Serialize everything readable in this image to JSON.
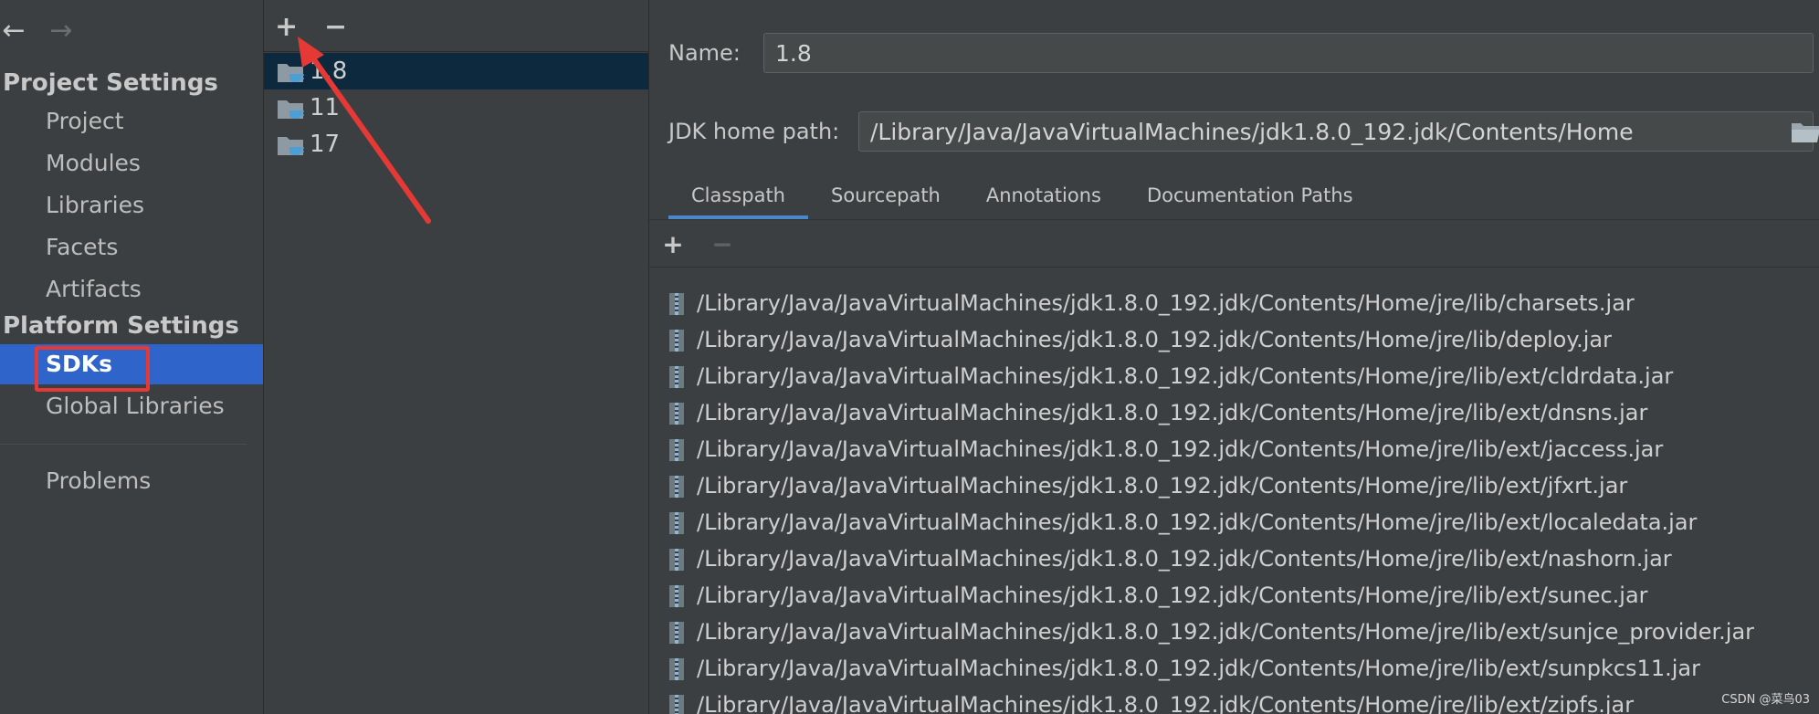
{
  "nav": {
    "back_glyph": "←",
    "forward_glyph": "→",
    "project_settings_title": "Project Settings",
    "project_items": [
      "Project",
      "Modules",
      "Libraries",
      "Facets",
      "Artifacts"
    ],
    "platform_settings_title": "Platform Settings",
    "platform_items": [
      "SDKs",
      "Global Libraries"
    ],
    "selected_item": "SDKs",
    "problems_label": "Problems"
  },
  "sdk_list": {
    "add_glyph": "+",
    "remove_glyph": "−",
    "items": [
      "1.8",
      "11",
      "17"
    ],
    "selected": "1.8"
  },
  "details": {
    "name_label": "Name:",
    "name_value": "1.8",
    "home_path_label": "JDK home path:",
    "home_path_value": "/Library/Java/JavaVirtualMachines/jdk1.8.0_192.jdk/Contents/Home",
    "tabs": [
      "Classpath",
      "Sourcepath",
      "Annotations",
      "Documentation Paths"
    ],
    "active_tab": "Classpath",
    "add_glyph": "+",
    "remove_glyph": "−",
    "classpath": [
      "/Library/Java/JavaVirtualMachines/jdk1.8.0_192.jdk/Contents/Home/jre/lib/charsets.jar",
      "/Library/Java/JavaVirtualMachines/jdk1.8.0_192.jdk/Contents/Home/jre/lib/deploy.jar",
      "/Library/Java/JavaVirtualMachines/jdk1.8.0_192.jdk/Contents/Home/jre/lib/ext/cldrdata.jar",
      "/Library/Java/JavaVirtualMachines/jdk1.8.0_192.jdk/Contents/Home/jre/lib/ext/dnsns.jar",
      "/Library/Java/JavaVirtualMachines/jdk1.8.0_192.jdk/Contents/Home/jre/lib/ext/jaccess.jar",
      "/Library/Java/JavaVirtualMachines/jdk1.8.0_192.jdk/Contents/Home/jre/lib/ext/jfxrt.jar",
      "/Library/Java/JavaVirtualMachines/jdk1.8.0_192.jdk/Contents/Home/jre/lib/ext/localedata.jar",
      "/Library/Java/JavaVirtualMachines/jdk1.8.0_192.jdk/Contents/Home/jre/lib/ext/nashorn.jar",
      "/Library/Java/JavaVirtualMachines/jdk1.8.0_192.jdk/Contents/Home/jre/lib/ext/sunec.jar",
      "/Library/Java/JavaVirtualMachines/jdk1.8.0_192.jdk/Contents/Home/jre/lib/ext/sunjce_provider.jar",
      "/Library/Java/JavaVirtualMachines/jdk1.8.0_192.jdk/Contents/Home/jre/lib/ext/sunpkcs11.jar",
      "/Library/Java/JavaVirtualMachines/jdk1.8.0_192.jdk/Contents/Home/jre/lib/ext/zipfs.jar"
    ]
  },
  "watermark": "CSDN @菜鸟03",
  "colors": {
    "background": "#3c3f41",
    "selection_blue": "#2f65ca",
    "list_selection": "#0d293e",
    "annotation_red": "#e53935",
    "tab_underline": "#4a88c7",
    "jdk_icon_blue": "#4b9fd5"
  },
  "icons": {
    "sdk_item": "jdk-folder-icon",
    "classpath_item": "jar-archive-icon",
    "home_path_browse": "folder-browse-icon"
  }
}
